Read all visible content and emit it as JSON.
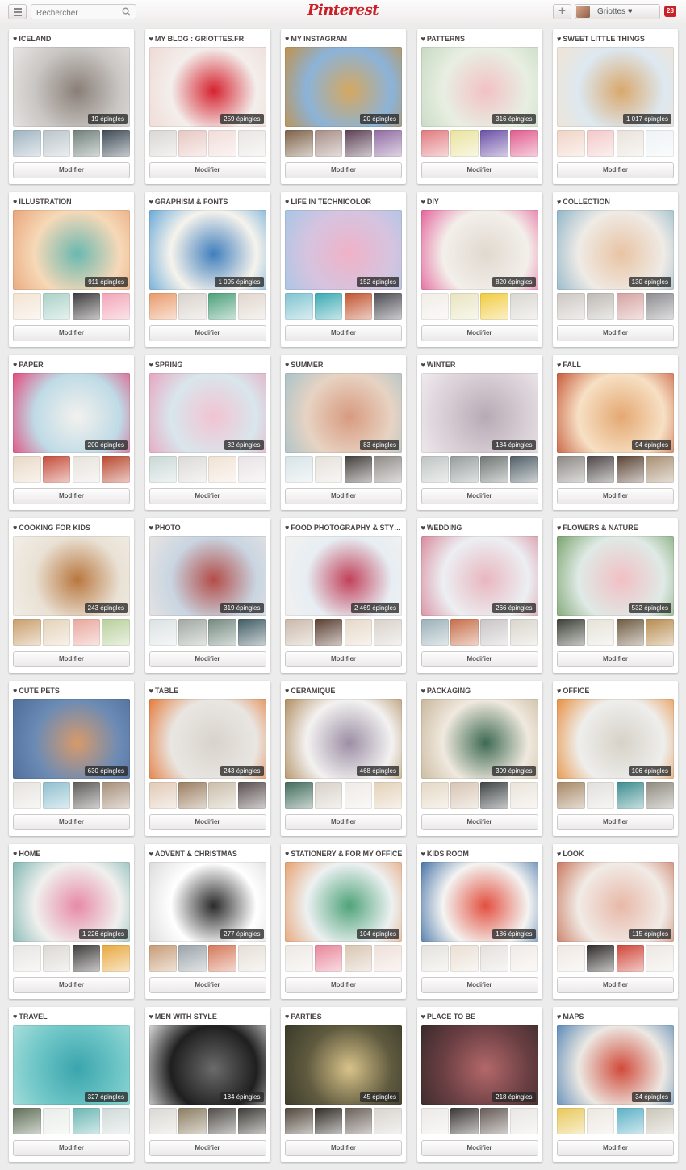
{
  "header": {
    "menu_icon": "menu-icon",
    "search_placeholder": "Rechercher",
    "logo": "Pinterest",
    "add_icon": "plus-icon",
    "user_name": "Griottes ♥",
    "notifications": "28"
  },
  "edit_label": "Modifier",
  "colors": {
    "brand": "#cb2027",
    "background": "#ececec"
  },
  "boards": [
    {
      "title": "ICELAND",
      "count": "19 épingles",
      "cover": [
        "#c9c6c3",
        "#8a7f78",
        "#e8e6e4"
      ],
      "thumbs": [
        "#9fb3c0",
        "#b9c4c9",
        "#6f7f7a",
        "#3c4954"
      ]
    },
    {
      "title": "MY BLOG : GRIOTTES.FR",
      "count": "259 épingles",
      "cover": [
        "#f3efec",
        "#d6222f",
        "#f0d9d4"
      ],
      "thumbs": [
        "#d9d6d3",
        "#e7c7c2",
        "#f1dcd8",
        "#e9e6e2"
      ]
    },
    {
      "title": "MY INSTAGRAM",
      "count": "20 épingles",
      "cover": [
        "#8bb3d9",
        "#d5a85f",
        "#c2924a"
      ],
      "thumbs": [
        "#7d6147",
        "#a68c85",
        "#5b3f54",
        "#8f6aa1"
      ]
    },
    {
      "title": "PATTERNS",
      "count": "316 épingles",
      "cover": [
        "#e8efe2",
        "#f2c1c6",
        "#c7d9c2"
      ],
      "thumbs": [
        "#e17a7e",
        "#e9e39d",
        "#6a4fa6",
        "#e05a8c"
      ]
    },
    {
      "title": "SWEET LITTLE THINGS",
      "count": "1 017 épingles",
      "cover": [
        "#dde8f0",
        "#d9a86c",
        "#f2e4d4"
      ],
      "thumbs": [
        "#f0d3c5",
        "#f3c8c8",
        "#e8e2da",
        "#eef3f6"
      ]
    },
    {
      "title": "ILLUSTRATION",
      "count": "911 épingles",
      "cover": [
        "#f6d9b8",
        "#6ab8b0",
        "#e9a57a"
      ],
      "thumbs": [
        "#f3e3d2",
        "#a9d1c6",
        "#3d3a3a",
        "#f2a3b6"
      ]
    },
    {
      "title": "GRAPHISM & FONTS",
      "count": "1 095 épingles",
      "cover": [
        "#f6f3ec",
        "#3f7fbd",
        "#69a9d8"
      ],
      "thumbs": [
        "#e99a6a",
        "#d8d2cb",
        "#4b9f7a",
        "#e0d6cd"
      ]
    },
    {
      "title": "LIFE IN TECHNICOLOR",
      "count": "152 épingles",
      "cover": [
        "#d5c4e0",
        "#f0b2c7",
        "#a7c6e6"
      ],
      "thumbs": [
        "#7ec3d0",
        "#3aa8b2",
        "#c0532e",
        "#4b4a52"
      ]
    },
    {
      "title": "DIY",
      "count": "820 épingles",
      "cover": [
        "#f3efea",
        "#e0d9cf",
        "#e4639c"
      ],
      "thumbs": [
        "#f1ede7",
        "#e8e4c0",
        "#f1cb3e",
        "#d9d6d0"
      ]
    },
    {
      "title": "COLLECTION",
      "count": "130 épingles",
      "cover": [
        "#efebe6",
        "#e9c3a3",
        "#8fb6c9"
      ],
      "thumbs": [
        "#cbc6c1",
        "#bdb8b2",
        "#d4a2a0",
        "#8c8b8f"
      ]
    },
    {
      "title": "PAPER",
      "count": "200 épingles",
      "cover": [
        "#bfdbe6",
        "#f3f1ee",
        "#e4497b"
      ],
      "thumbs": [
        "#e9d8c5",
        "#c54c3b",
        "#e7e2db",
        "#b8472f"
      ]
    },
    {
      "title": "SPRING",
      "count": "32 épingles",
      "cover": [
        "#d9e6ec",
        "#f2c3d2",
        "#e7a5bf"
      ],
      "thumbs": [
        "#c8d8d5",
        "#dcdad7",
        "#f0e2d4",
        "#e8e3e6"
      ]
    },
    {
      "title": "SUMMER",
      "count": "83 épingles",
      "cover": [
        "#e7d3c3",
        "#d89a7f",
        "#a8c3c9"
      ],
      "thumbs": [
        "#d7e3e7",
        "#e5e1da",
        "#433e3a",
        "#8f8a86"
      ]
    },
    {
      "title": "WINTER",
      "count": "184 épingles",
      "cover": [
        "#d9cfd6",
        "#b7aab5",
        "#f0ebee"
      ],
      "thumbs": [
        "#bec4c3",
        "#959c9c",
        "#6e7674",
        "#4f5e66"
      ]
    },
    {
      "title": "FALL",
      "count": "94 épingles",
      "cover": [
        "#f7e0c4",
        "#e4a872",
        "#c75a3b"
      ],
      "thumbs": [
        "#8b8682",
        "#4f4646",
        "#5a4334",
        "#a78f71"
      ]
    },
    {
      "title": "COOKING FOR KIDS",
      "count": "243 épingles",
      "cover": [
        "#e9e1d4",
        "#b9773f",
        "#f2efe9"
      ],
      "thumbs": [
        "#c99e6c",
        "#e4d2b8",
        "#e8a69c",
        "#b7cf9a"
      ]
    },
    {
      "title": "PHOTO",
      "count": "319 épingles",
      "cover": [
        "#c9d5e1",
        "#b34c48",
        "#e8e4e2"
      ],
      "thumbs": [
        "#dbe2e3",
        "#9fa8a0",
        "#74897f",
        "#3f5b63"
      ]
    },
    {
      "title": "FOOD PHOTOGRAPHY & STYLING",
      "count": "2 469 épingles",
      "cover": [
        "#e7eef3",
        "#c2405a",
        "#f4f1f0"
      ],
      "thumbs": [
        "#c9b8a9",
        "#5a3d2f",
        "#e6d8c8",
        "#d8d1c9"
      ]
    },
    {
      "title": "WEDDING",
      "count": "266 épingles",
      "cover": [
        "#eceff2",
        "#e9b6c0",
        "#d98a9c"
      ],
      "thumbs": [
        "#9ab0b8",
        "#c66d48",
        "#c9c4c6",
        "#d9d5cc"
      ]
    },
    {
      "title": "FLOWERS & NATURE",
      "count": "532 épingles",
      "cover": [
        "#dfeae6",
        "#f2bfc4",
        "#7aa36b"
      ],
      "thumbs": [
        "#3c3f36",
        "#e6e2d8",
        "#6e5a3f",
        "#b78b4e"
      ]
    },
    {
      "title": "CUTE PETS",
      "count": "630 épingles",
      "cover": [
        "#6b8bb5",
        "#d79a6b",
        "#4d6c99"
      ],
      "thumbs": [
        "#e6e3de",
        "#8ebfcf",
        "#5c5a57",
        "#a58d78"
      ]
    },
    {
      "title": "TABLE",
      "count": "243 épingles",
      "cover": [
        "#e9e6e2",
        "#d9d3cc",
        "#e57a3a"
      ],
      "thumbs": [
        "#e1c9b6",
        "#9a7d5f",
        "#c9bda9",
        "#5a4d4f"
      ]
    },
    {
      "title": "CERAMIQUE",
      "count": "468 épingles",
      "cover": [
        "#f3f2f1",
        "#9c8ea5",
        "#b08d5f"
      ],
      "thumbs": [
        "#3f6b5a",
        "#d7d0c8",
        "#eeeae6",
        "#e3d1b8"
      ]
    },
    {
      "title": "PACKAGING",
      "count": "309 épingles",
      "cover": [
        "#f0e9df",
        "#3d6a52",
        "#c8b79b"
      ],
      "thumbs": [
        "#e4d7c4",
        "#d6c4b2",
        "#3c4242",
        "#eae3d9"
      ]
    },
    {
      "title": "OFFICE",
      "count": "106 épingles",
      "cover": [
        "#eeeeec",
        "#d7d2c8",
        "#e88f3e"
      ],
      "thumbs": [
        "#a68765",
        "#e2dfdb",
        "#3b8c8f",
        "#8f8a7e"
      ]
    },
    {
      "title": "HOME",
      "count": "1 226 épingles",
      "cover": [
        "#f0f0ee",
        "#e78aa8",
        "#7fb7b3"
      ],
      "thumbs": [
        "#e7e5e2",
        "#dbd8d3",
        "#3e3b3a",
        "#e8a73d"
      ]
    },
    {
      "title": "ADVENT & CHRISTMAS",
      "count": "277 épingles",
      "cover": [
        "#ffffff",
        "#2a2a2a",
        "#dcdcdc"
      ],
      "thumbs": [
        "#c79b77",
        "#9aa2a8",
        "#d5785a",
        "#e5dfd6"
      ]
    },
    {
      "title": "STATIONERY & FOR MY OFFICE",
      "count": "104 épingles",
      "cover": [
        "#edf1f2",
        "#4fa37a",
        "#e8a06f"
      ],
      "thumbs": [
        "#ede9e4",
        "#e7859a",
        "#d8c5b1",
        "#eedfd8"
      ]
    },
    {
      "title": "KIDS ROOM",
      "count": "186 épingles",
      "cover": [
        "#f4f4f2",
        "#e34f3f",
        "#4875a8"
      ],
      "thumbs": [
        "#e5e2dc",
        "#eadfd3",
        "#e4e0dc",
        "#f0eae6"
      ]
    },
    {
      "title": "LOOK",
      "count": "115 épingles",
      "cover": [
        "#f1ebe6",
        "#e8b8a8",
        "#c9785e"
      ],
      "thumbs": [
        "#efe8e2",
        "#2e2a29",
        "#cf4436",
        "#ece7e2"
      ]
    },
    {
      "title": "TRAVEL",
      "count": "327 épingles",
      "cover": [
        "#6fc6c7",
        "#3aa5ad",
        "#a9dfdc"
      ],
      "thumbs": [
        "#5f6e57",
        "#e9ede9",
        "#6ab5b3",
        "#cfd9d9"
      ]
    },
    {
      "title": "MEN WITH STYLE",
      "count": "184 épingles",
      "cover": [
        "#1f1f1f",
        "#6b6b6b",
        "#d9d9d9"
      ],
      "thumbs": [
        "#d9d8d3",
        "#8a7c60",
        "#4f4b48",
        "#3c3a36"
      ]
    },
    {
      "title": "PARTIES",
      "count": "45 épingles",
      "cover": [
        "#5f5a3f",
        "#d9c38a",
        "#3a3a2a"
      ],
      "thumbs": [
        "#51463a",
        "#2f2a24",
        "#6a5f58",
        "#d7d3ce"
      ]
    },
    {
      "title": "PLACE TO BE",
      "count": "218 épingles",
      "cover": [
        "#6a3f43",
        "#b4686a",
        "#3a2a2b"
      ],
      "thumbs": [
        "#ece9e6",
        "#3b3634",
        "#655a56",
        "#e9e6e3"
      ]
    },
    {
      "title": "MAPS",
      "count": "34 épingles",
      "cover": [
        "#ece8e2",
        "#d14a3a",
        "#5a8ab8"
      ],
      "thumbs": [
        "#e8c85a",
        "#ece7df",
        "#5bb0c5",
        "#c9c5b8"
      ]
    }
  ]
}
